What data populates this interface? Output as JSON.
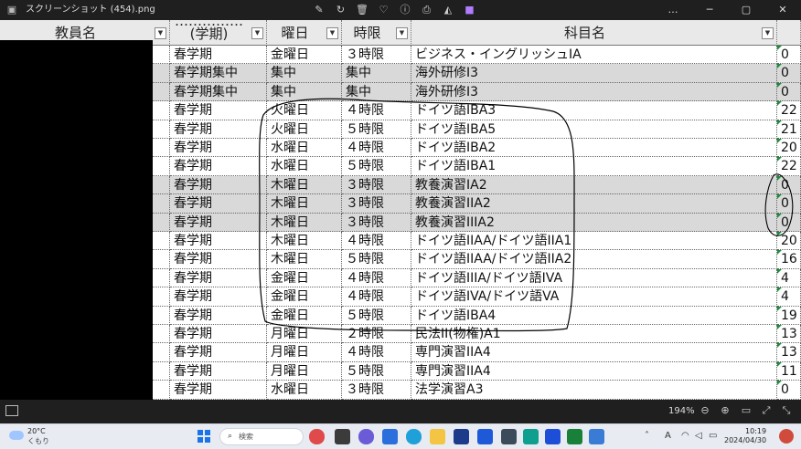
{
  "window": {
    "title": "スクリーンショット (454).png",
    "toolbar_icons": [
      "crop-icon",
      "rotate-icon",
      "delete-icon",
      "favorite-icon",
      "info-icon",
      "print-icon",
      "edit-icon",
      "clipchamp-icon"
    ],
    "win_controls": [
      "…",
      "─",
      "▢",
      "✕"
    ]
  },
  "table": {
    "columns": [
      {
        "label": "教員名"
      },
      {
        "label_top": "……………",
        "label_bottom": "(学期)"
      },
      {
        "label": "曜日"
      },
      {
        "label": "時限"
      },
      {
        "label": "科目名"
      },
      {
        "label": ""
      }
    ],
    "rows": [
      {
        "term": "春学期",
        "day": "金曜日",
        "period": "３時限",
        "subject": "ビジネス・イングリッシュIA",
        "num": "0",
        "shade": false
      },
      {
        "term": "春学期集中",
        "day": "集中",
        "period": "集中",
        "subject": "海外研修I3",
        "num": "0",
        "shade": true
      },
      {
        "term": "春学期集中",
        "day": "集中",
        "period": "集中",
        "subject": "海外研修I3",
        "num": "0",
        "shade": true
      },
      {
        "term": "春学期",
        "day": "火曜日",
        "period": "４時限",
        "subject": "ドイツ語IBA3",
        "num": "22",
        "shade": false
      },
      {
        "term": "春学期",
        "day": "火曜日",
        "period": "５時限",
        "subject": "ドイツ語IBA5",
        "num": "21",
        "shade": false
      },
      {
        "term": "春学期",
        "day": "水曜日",
        "period": "４時限",
        "subject": "ドイツ語IBA2",
        "num": "20",
        "shade": false
      },
      {
        "term": "春学期",
        "day": "水曜日",
        "period": "５時限",
        "subject": "ドイツ語IBA1",
        "num": "22",
        "shade": false
      },
      {
        "term": "春学期",
        "day": "木曜日",
        "period": "３時限",
        "subject": "教養演習IA2",
        "num": "0",
        "shade": true
      },
      {
        "term": "春学期",
        "day": "木曜日",
        "period": "３時限",
        "subject": "教養演習IIA2",
        "num": "0",
        "shade": true
      },
      {
        "term": "春学期",
        "day": "木曜日",
        "period": "３時限",
        "subject": "教養演習IIIA2",
        "num": "0",
        "shade": true
      },
      {
        "term": "春学期",
        "day": "木曜日",
        "period": "４時限",
        "subject": "ドイツ語IIAA/ドイツ語IIA1",
        "num": "20",
        "shade": false
      },
      {
        "term": "春学期",
        "day": "木曜日",
        "period": "５時限",
        "subject": "ドイツ語IIAA/ドイツ語IIA2",
        "num": "16",
        "shade": false
      },
      {
        "term": "春学期",
        "day": "金曜日",
        "period": "４時限",
        "subject": "ドイツ語IIIA/ドイツ語IVA",
        "num": "4",
        "shade": false
      },
      {
        "term": "春学期",
        "day": "金曜日",
        "period": "４時限",
        "subject": "ドイツ語IVA/ドイツ語VA",
        "num": "4",
        "shade": false
      },
      {
        "term": "春学期",
        "day": "金曜日",
        "period": "５時限",
        "subject": "ドイツ語IBA4",
        "num": "19",
        "shade": false
      },
      {
        "term": "春学期",
        "day": "月曜日",
        "period": "２時限",
        "subject": "民法II(物権)A1",
        "num": "13",
        "shade": false
      },
      {
        "term": "春学期",
        "day": "月曜日",
        "period": "４時限",
        "subject": "専門演習IIA4",
        "num": "13",
        "shade": false
      },
      {
        "term": "春学期",
        "day": "月曜日",
        "period": "５時限",
        "subject": "専門演習IIA4",
        "num": "11",
        "shade": false
      },
      {
        "term": "春学期",
        "day": "水曜日",
        "period": "３時限",
        "subject": "法学演習A3",
        "num": "0",
        "shade": false
      }
    ]
  },
  "statusbar": {
    "zoom": "194%"
  },
  "taskbar": {
    "weather_temp": "20°C",
    "weather_desc": "くもり",
    "search_placeholder": "検索",
    "time": "10:19",
    "date": "2024/04/30",
    "ime": "A"
  }
}
